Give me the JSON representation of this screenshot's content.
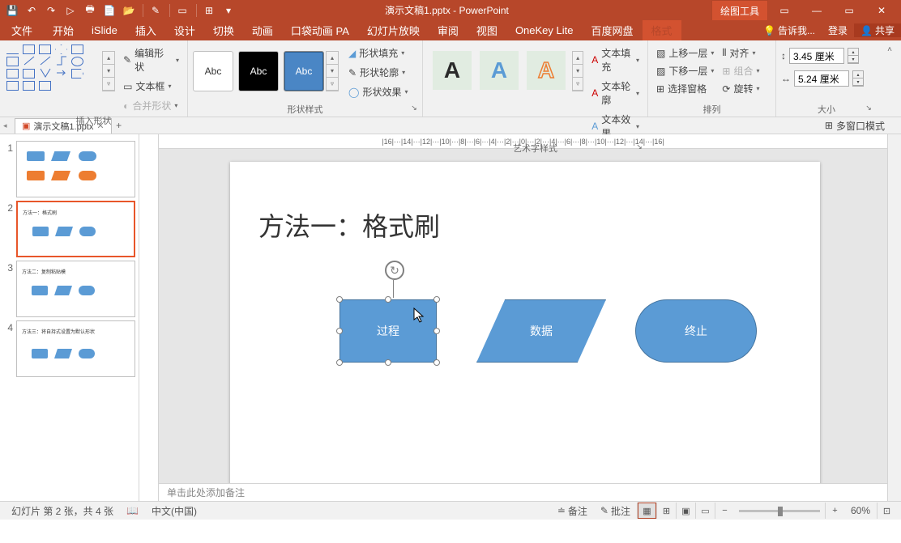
{
  "app": {
    "title": "演示文稿1.pptx - PowerPoint",
    "tool_context": "绘图工具"
  },
  "window_controls": {
    "min": "—",
    "max": "▭",
    "close": "✕",
    "ribbon_opts": "▭"
  },
  "qat": {
    "save": "💾",
    "undo": "↶",
    "redo": "↷",
    "start": "▷",
    "print": "🖶",
    "new": "📄",
    "open": "📂",
    "format_painter": "✎",
    "shape": "▭",
    "quick_layout": "⊞"
  },
  "tabs": {
    "file": "文件",
    "home": "开始",
    "islide": "iSlide",
    "insert": "插入",
    "design": "设计",
    "transitions": "切换",
    "animations": "动画",
    "pocket": "口袋动画 PA",
    "slideshow": "幻灯片放映",
    "review": "审阅",
    "view": "视图",
    "onekey": "OneKey Lite",
    "baidu": "百度网盘",
    "format": "格式"
  },
  "help": {
    "tell": "告诉我...",
    "login": "登录",
    "share": "共享"
  },
  "ribbon": {
    "insert_shapes": {
      "label": "插入形状",
      "edit": "编辑形状",
      "textbox": "文本框",
      "merge": "合并形状"
    },
    "shape_styles": {
      "label": "形状样式",
      "abc": "Abc",
      "fill": "形状填充",
      "outline": "形状轮廓",
      "effects": "形状效果"
    },
    "wordart": {
      "label": "艺术字样式",
      "glyph": "A",
      "fill": "文本填充",
      "outline": "文本轮廓",
      "effects": "文本效果"
    },
    "arrange": {
      "label": "排列",
      "forward": "上移一层",
      "backward": "下移一层",
      "pane": "选择窗格",
      "align": "对齐",
      "group": "组合",
      "rotate": "旋转"
    },
    "size": {
      "label": "大小",
      "height": "3.45 厘米",
      "width": "5.24 厘米"
    }
  },
  "file_tab": {
    "name": "演示文稿1.pptx"
  },
  "multiwindow": "多窗口模式",
  "hruler": "|16|···|14|···|12|···|10|···|8|···|6|···|4|···|2|···|0|···|2|···|4|···|6|···|8|···|10|···|12|···|14|···|16|",
  "slide": {
    "heading": "方法一：格式刷",
    "shape1": "过程",
    "shape2": "数据",
    "shape3": "终止"
  },
  "thumbs": {
    "t1": "1",
    "t2": "2",
    "t3": "3",
    "t4": "4"
  },
  "notes": "单击此处添加备注",
  "status": {
    "slide": "幻灯片 第 2 张，共 4 张",
    "lang": "中文(中国)",
    "notes": "备注",
    "comments": "批注",
    "zoom": "60%",
    "minus": "−",
    "plus": "+"
  }
}
